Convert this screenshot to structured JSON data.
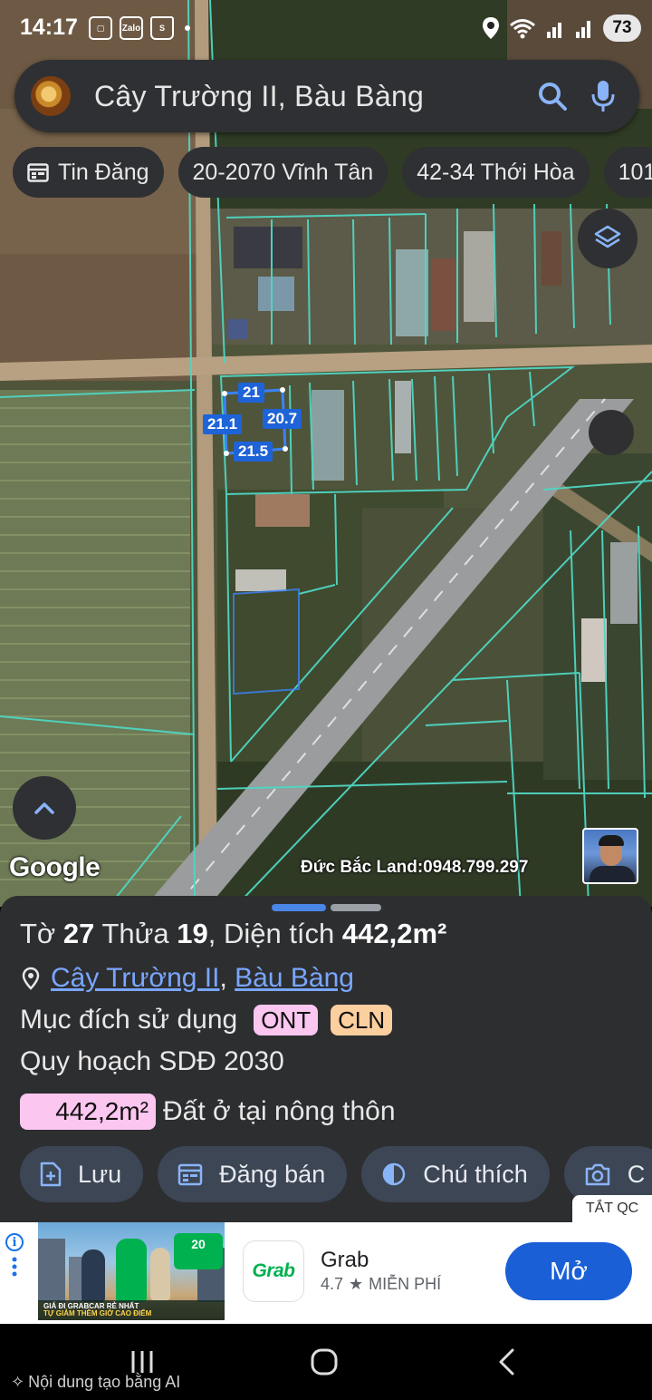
{
  "status_bar": {
    "time": "14:17",
    "zalo": "Zalo",
    "battery": "73"
  },
  "search": {
    "query": "Cây Trường II, Bàu Bàng"
  },
  "chips": [
    {
      "label": "Tin Đăng",
      "icon": "calendar-icon"
    },
    {
      "label": "20-2070 Vĩnh Tân"
    },
    {
      "label": "42-34 Thới Hòa"
    },
    {
      "label": "101"
    }
  ],
  "map": {
    "logo": "Google",
    "watermark": "Đức Bắc Land:0948.799.297",
    "dimensions": {
      "top": "21",
      "left": "21.1",
      "right": "20.7",
      "bottom": "21.5"
    }
  },
  "sheet": {
    "title_prefix": "Tờ",
    "sheet_no": "27",
    "parcel_label": "Thửa",
    "parcel_no": "19",
    "area_label": ", Diện tích",
    "area_value": "442,2m²",
    "location_link_1": "Cây Trường II",
    "location_sep": ",",
    "location_link_2": "Bàu Bàng",
    "purpose_label": "Mục đích sử dụng",
    "purpose_tags": [
      {
        "label": "ONT",
        "color": "#fbc6f0"
      },
      {
        "label": "CLN",
        "color": "#fbcf9e"
      }
    ],
    "plan_label": "Quy hoạch SDĐ 2030",
    "plan_area": "442,2m²",
    "plan_use": "Đất ở tại nông thôn",
    "actions": [
      {
        "label": "Lưu",
        "icon": "save-plus-icon"
      },
      {
        "label": "Đăng bán",
        "icon": "calendar-icon"
      },
      {
        "label": "Chú thích",
        "icon": "contrast-icon"
      },
      {
        "label": "C",
        "icon": "camera-icon"
      }
    ]
  },
  "ad": {
    "close_label": "TẮT QC",
    "app_name": "Grab",
    "logo_text": "Grab",
    "rating": "4.7",
    "price": "MIỄN PHÍ",
    "open_label": "Mở",
    "promo_text": "20",
    "caption_line1": "GIÁ ĐI GRABCAR RẺ NHẤT",
    "caption_line2": "TỰ GIẢM THÊM GIỜ CAO ĐIỂM",
    "brand_color": "#00b14f",
    "button_color": "#1a5fd6"
  },
  "nav": {
    "ai_note": "Nội dung tạo bằng AI"
  }
}
